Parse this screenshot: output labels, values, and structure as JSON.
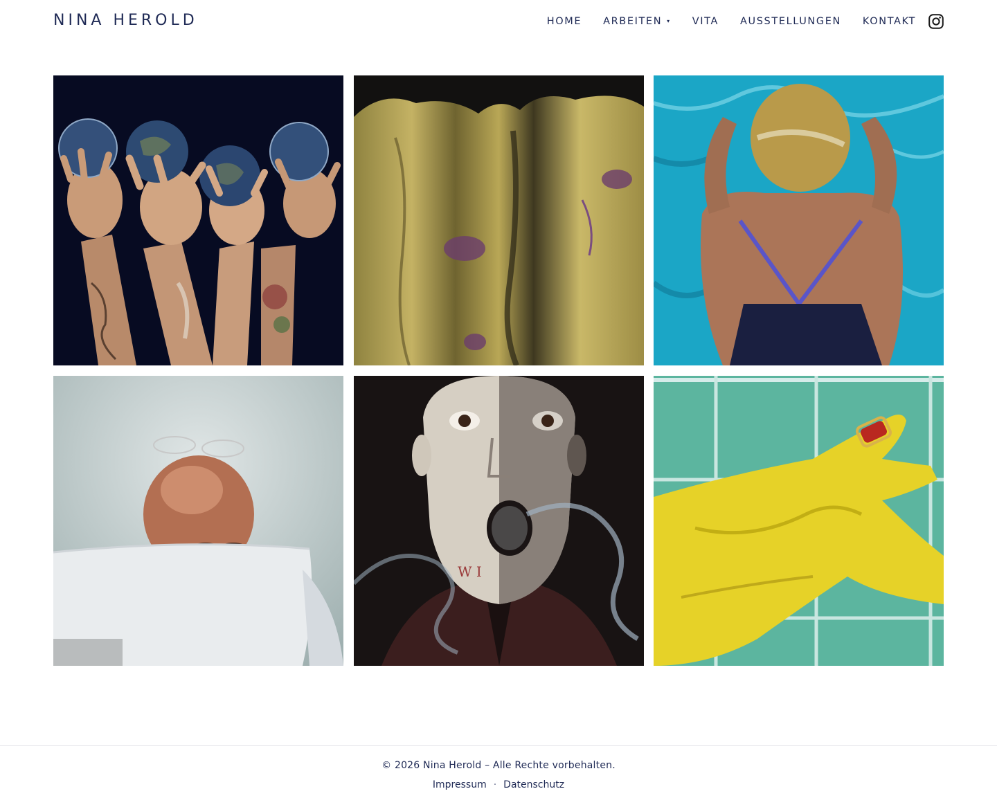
{
  "site": {
    "logo": "NINA HEROLD"
  },
  "nav": {
    "items": [
      {
        "label": "HOME"
      },
      {
        "label": "ARBEITEN",
        "caret": "▾"
      },
      {
        "label": "VITA"
      },
      {
        "label": "AUSSTELLUNGEN"
      },
      {
        "label": "KONTAKT"
      }
    ],
    "social_icon": "instagram-icon"
  },
  "gallery": {
    "tiles": [
      {
        "subject": "hands-holding-globes-painting",
        "colors": [
          "#0a1030",
          "#c89a78",
          "#3d5e8a"
        ]
      },
      {
        "subject": "yellow-draped-fabric-painting",
        "colors": [
          "#14130f",
          "#b9a651",
          "#6b3d6b"
        ]
      },
      {
        "subject": "swimmer-in-pool-painting",
        "colors": [
          "#1aa8c7",
          "#b07a5e",
          "#c9a64a"
        ]
      },
      {
        "subject": "man-behind-pillow-painting",
        "colors": [
          "#c9d3d3",
          "#b8745a",
          "#e8ecef"
        ]
      },
      {
        "subject": "surprised-man-smoke-painting",
        "colors": [
          "#1a1414",
          "#d8d1c6",
          "#7e8a97"
        ]
      },
      {
        "subject": "yellow-glove-on-tiles-painting",
        "colors": [
          "#5fb7a0",
          "#e6d32a",
          "#b92820"
        ]
      }
    ]
  },
  "footer": {
    "copyright": "© 2026 Nina Herold – Alle Rechte vorbehalten.",
    "links": [
      {
        "label": "Impressum"
      },
      {
        "label": "Datenschutz"
      }
    ],
    "separator": "·"
  },
  "colors": {
    "brand": "#1f2a55",
    "background": "#ffffff",
    "divider": "#e6e6ea"
  }
}
